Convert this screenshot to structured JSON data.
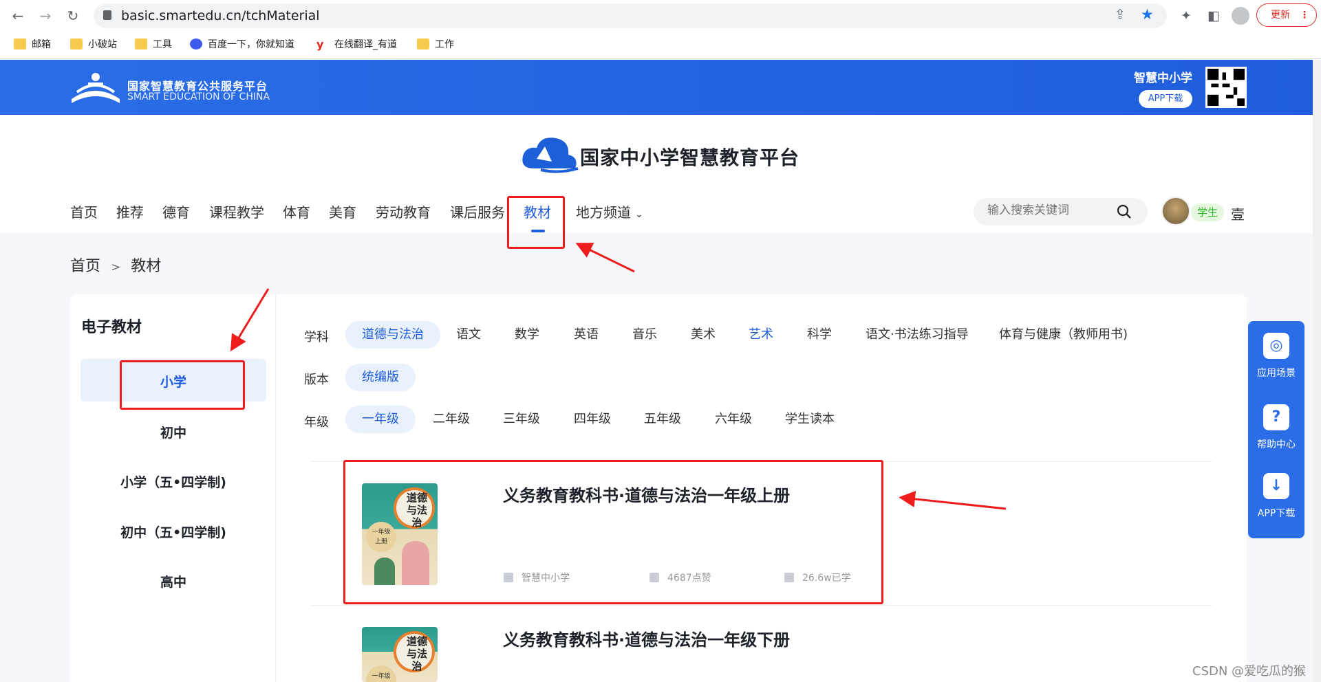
{
  "browser": {
    "url": "basic.smartedu.cn/tchMaterial",
    "update_label": "更新",
    "bookmarks": [
      "邮箱",
      "小破站",
      "工具",
      "百度一下，你就知道",
      "在线翻译_有道",
      "工作"
    ]
  },
  "banner": {
    "logo_cn": "国家智慧教育公共服务平台",
    "logo_en": "SMART EDUCATION OF CHINA",
    "app_title": "智慧中小学",
    "app_download": "APP下载"
  },
  "header": {
    "platform_name": "国家中小学智慧教育平台",
    "nav": [
      "首页",
      "推荐",
      "德育",
      "课程教学",
      "体育",
      "美育",
      "劳动教育",
      "课后服务",
      "教材",
      "地方频道"
    ],
    "active_nav": "教材",
    "search_placeholder": "输入搜索关键词",
    "user_badge": "学生",
    "user_name": "壹"
  },
  "breadcrumb": {
    "home": "首页",
    "sep": ">",
    "current": "教材"
  },
  "sidebar": {
    "title": "电子教材",
    "items": [
      "小学",
      "初中",
      "小学（五•四学制)",
      "初中（五•四学制)",
      "高中"
    ],
    "active": "小学"
  },
  "filters": {
    "subject_label": "学科",
    "subjects": [
      "道德与法治",
      "语文",
      "数学",
      "英语",
      "音乐",
      "美术",
      "艺术",
      "科学",
      "语文·书法练习指导",
      "体育与健康（教师用书)"
    ],
    "active_subject": "道德与法治",
    "edition_label": "版本",
    "editions": [
      "统编版"
    ],
    "grade_label": "年级",
    "grades": [
      "一年级",
      "二年级",
      "三年级",
      "四年级",
      "五年级",
      "六年级",
      "学生读本"
    ],
    "active_grade": "一年级"
  },
  "books": [
    {
      "title": "义务教育教科书·道德与法治一年级上册",
      "cover_text": "道德与法治",
      "cover_grade": "一年级",
      "cover_volume": "上册",
      "source": "智慧中小学",
      "likes": "4687点赞",
      "learners": "26.6w已学"
    },
    {
      "title": "义务教育教科书·道德与法治一年级下册",
      "cover_text": "道德与法治",
      "cover_grade": "一年级"
    }
  ],
  "float_menu": [
    "应用场景",
    "帮助中心",
    "APP下载"
  ],
  "watermark": "CSDN @爱吃瓜的猴",
  "colors": {
    "brand_blue": "#2a6de6",
    "active_blue": "#1f5ddd",
    "annotation_red": "#ee1c1c"
  }
}
